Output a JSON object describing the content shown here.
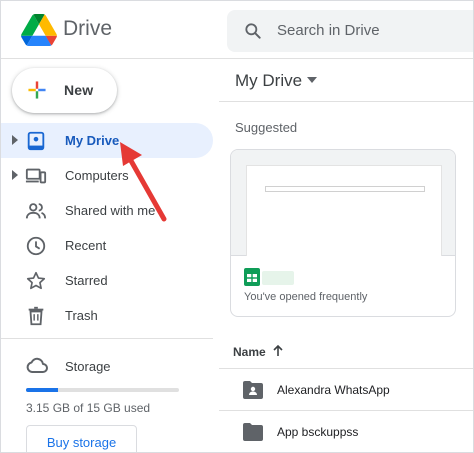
{
  "header": {
    "app_title": "Drive",
    "search_placeholder": "Search in Drive"
  },
  "sidebar": {
    "new_label": "New",
    "items": [
      {
        "label": "My Drive",
        "icon": "my-drive-icon",
        "active": true,
        "expandable": true
      },
      {
        "label": "Computers",
        "icon": "computers-icon",
        "active": false,
        "expandable": true
      },
      {
        "label": "Shared with me",
        "icon": "shared-with-me-icon",
        "active": false,
        "expandable": false
      },
      {
        "label": "Recent",
        "icon": "clock-icon",
        "active": false,
        "expandable": false
      },
      {
        "label": "Starred",
        "icon": "star-icon",
        "active": false,
        "expandable": false
      },
      {
        "label": "Trash",
        "icon": "trash-icon",
        "active": false,
        "expandable": false
      }
    ],
    "storage": {
      "label": "Storage",
      "usage_text": "3.15 GB of 15 GB used",
      "used_fraction": 0.21,
      "buy_label": "Buy storage"
    }
  },
  "main": {
    "title": "My Drive",
    "suggested_label": "Suggested",
    "suggested_card": {
      "subtitle": "You've opened frequently",
      "icon": "google-sheets-icon"
    },
    "list_header": "Name",
    "rows": [
      {
        "label": "Alexandra WhatsApp",
        "icon": "shared-folder-icon"
      },
      {
        "label": "App bsckuppss",
        "icon": "folder-icon"
      }
    ]
  },
  "colors": {
    "accent": "#1a73e8",
    "active_bg": "#e8f0fe",
    "active_text": "#185abc",
    "annotation_arrow": "#e53935"
  }
}
